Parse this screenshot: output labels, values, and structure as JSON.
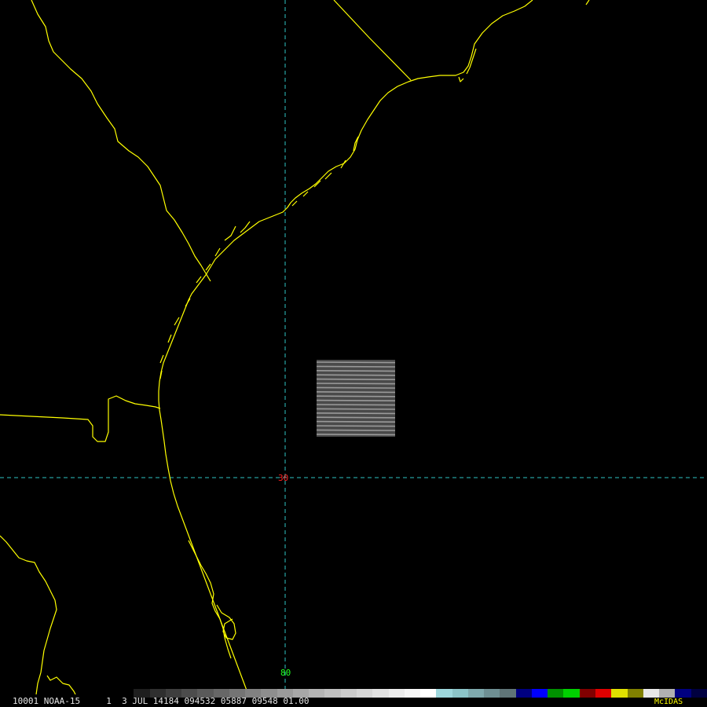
{
  "map": {
    "coastline_color": "#ffff00",
    "grid_color": "#2ec4c4",
    "lat_label": {
      "text": "30",
      "color": "#ff2020"
    },
    "lon_label": {
      "text": "80",
      "color": "#20ff20"
    }
  },
  "status_bar": {
    "text": "10001 NOAA-15     1  3 JUL 14184 094532 05887 09548 01.00",
    "brand": "McIDAS",
    "brand_color": "#ffff00"
  },
  "colorbar": {
    "colors": [
      "#000000",
      "#1e1e1e",
      "#2f2f2f",
      "#3e3e3e",
      "#4c4c4c",
      "#5a5a5a",
      "#676767",
      "#747474",
      "#818181",
      "#8e8e8e",
      "#9b9b9b",
      "#a8a8a8",
      "#b4b4b4",
      "#c0c0c0",
      "#cbcbcb",
      "#d6d6d6",
      "#e1e1e1",
      "#ececec",
      "#f6f6f6",
      "#ffffff",
      "#9ed7dc",
      "#8cc4c8",
      "#7fa9ad",
      "#6e8f93",
      "#5f7477",
      "#000080",
      "#0000ff",
      "#009000",
      "#00d000",
      "#800000",
      "#e00000",
      "#e0e000",
      "#808000",
      "#e8e8e8",
      "#b0b0b0",
      "#000080",
      "#000040"
    ]
  }
}
